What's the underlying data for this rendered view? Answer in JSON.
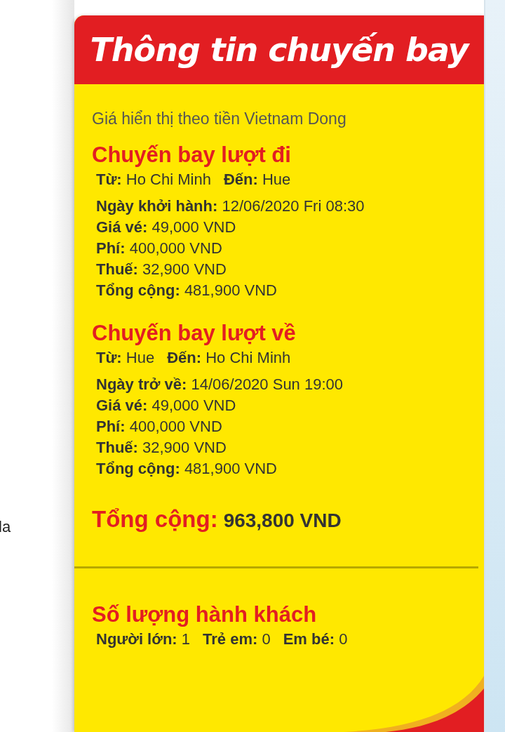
{
  "side_text": "la",
  "card": {
    "title": "Thông tin chuyến bay",
    "currency_note": "Giá hiển thị theo tiền Vietnam Dong",
    "flights": [
      {
        "title": "Chuyến bay lượt đi",
        "lines": [
          [
            {
              "label": "Từ:",
              "value": "Ho Chi Minh"
            },
            {
              "label": "Đến:",
              "value": "Hue"
            }
          ],
          [
            {
              "label": "Ngày khởi hành:",
              "value": "12/06/2020 Fri 08:30"
            }
          ],
          [
            {
              "label": "Giá vé:",
              "value": "49,000 VND"
            }
          ],
          [
            {
              "label": "Phí:",
              "value": "400,000 VND"
            }
          ],
          [
            {
              "label": "Thuế:",
              "value": "32,900 VND"
            }
          ],
          [
            {
              "label": "Tổng cộng:",
              "value": "481,900 VND"
            }
          ]
        ]
      },
      {
        "title": "Chuyến bay lượt về",
        "lines": [
          [
            {
              "label": "Từ:",
              "value": "Hue"
            },
            {
              "label": "Đến:",
              "value": "Ho Chi Minh"
            }
          ],
          [
            {
              "label": "Ngày trở về:",
              "value": "14/06/2020 Sun 19:00"
            }
          ],
          [
            {
              "label": "Giá vé:",
              "value": "49,000 VND"
            }
          ],
          [
            {
              "label": "Phí:",
              "value": "400,000 VND"
            }
          ],
          [
            {
              "label": "Thuế:",
              "value": "32,900 VND"
            }
          ],
          [
            {
              "label": "Tổng cộng:",
              "value": "481,900 VND"
            }
          ]
        ]
      }
    ],
    "grand_total": {
      "label": "Tổng cộng:",
      "value": "963,800 VND"
    },
    "passengers": {
      "title": "Số lượng hành khách",
      "items": [
        {
          "label": "Người lớn:",
          "value": "1"
        },
        {
          "label": "Trẻ em:",
          "value": "0"
        },
        {
          "label": "Em bé:",
          "value": "0"
        }
      ]
    }
  }
}
